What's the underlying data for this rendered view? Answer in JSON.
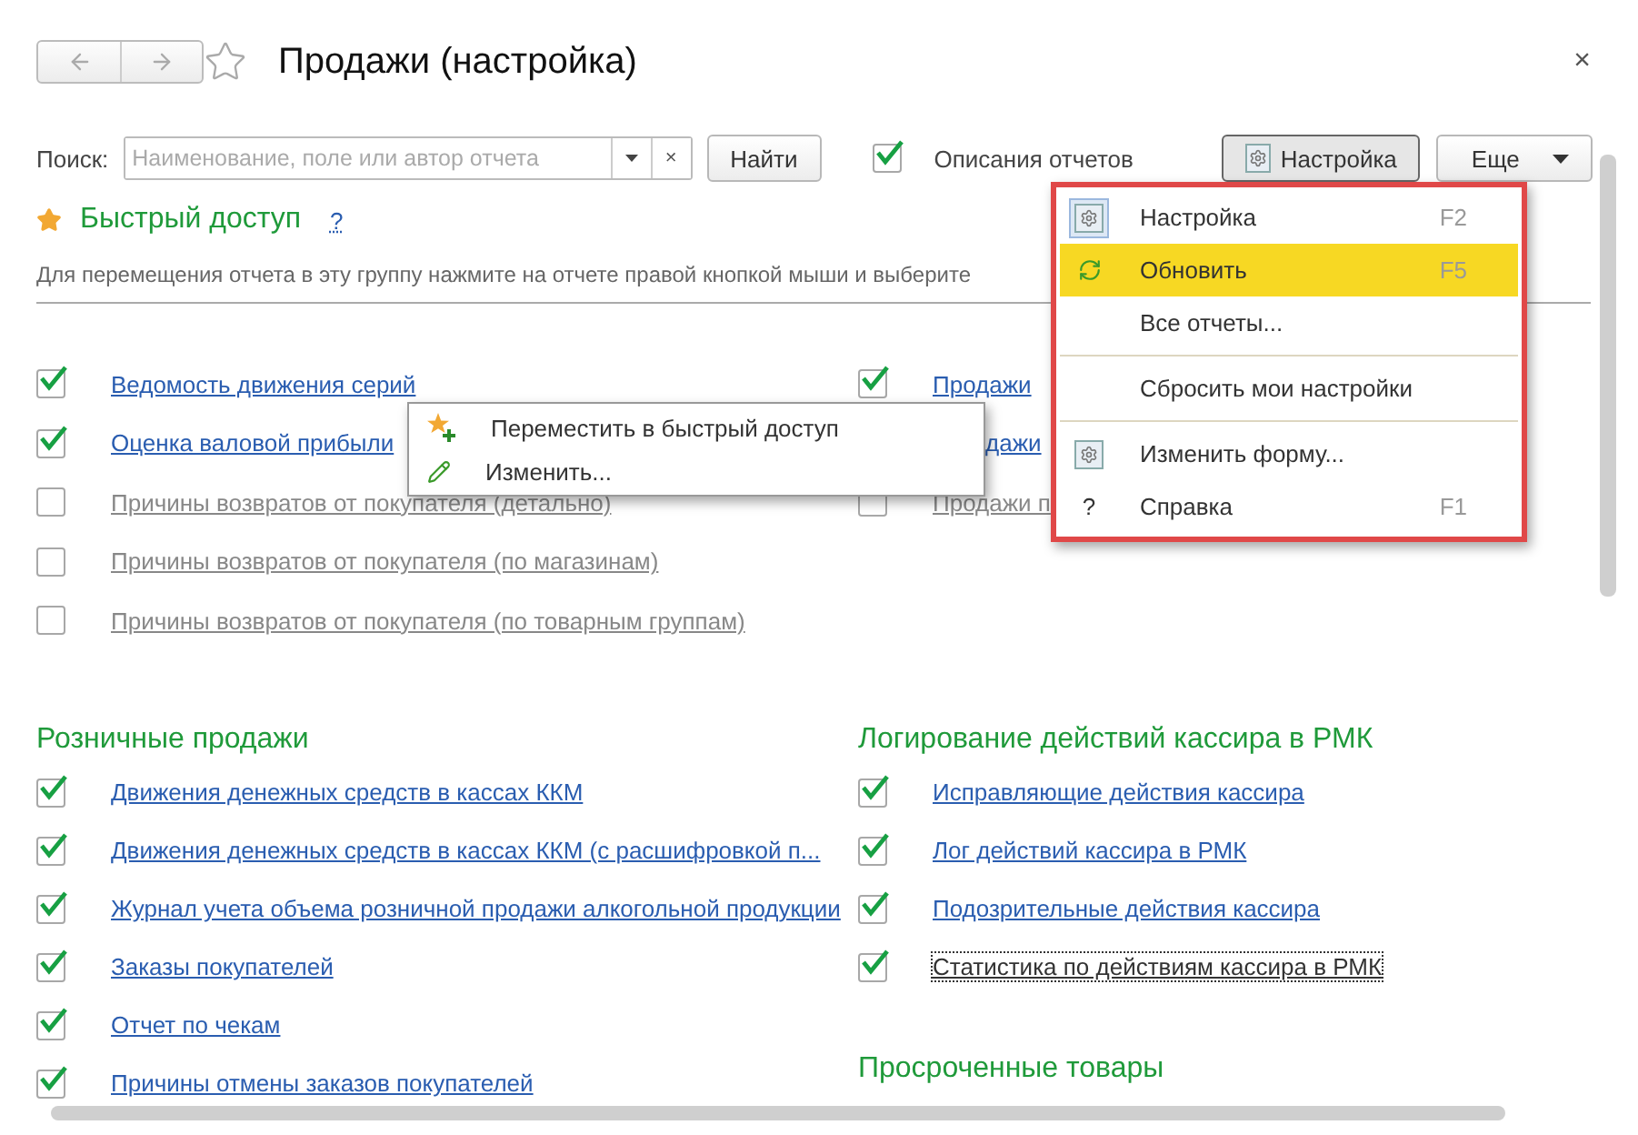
{
  "window": {
    "title": "Продажи (настройка)",
    "close": "×"
  },
  "search": {
    "label": "Поиск:",
    "placeholder": "Наименование, поле или автор отчета",
    "clear": "×"
  },
  "find_button": "Найти",
  "descriptions": {
    "label": "Описания отчетов",
    "checked": true
  },
  "settings_button": {
    "label": "Настройка",
    "pressed": true
  },
  "more_button": "Еще",
  "quick_access": {
    "title": "Быстрый доступ",
    "help": "?",
    "hint": "Для перемещения отчета в эту группу нажмите на отчете правой кнопкой мыши и выберите",
    "left": [
      {
        "label": "Ведомость движения серий",
        "checked": true
      },
      {
        "label": "Оценка валовой прибыли",
        "checked": true
      },
      {
        "label": "Причины возвратов от покупателя (детально)",
        "checked": false
      },
      {
        "label": "Причины возвратов от покупателя (по магазинам)",
        "checked": false
      },
      {
        "label": "Причины возвратов от покупателя (по товарным группам)",
        "checked": false
      }
    ],
    "right": [
      {
        "label": "Продажи",
        "checked": true,
        "covered": false
      },
      {
        "label": "дажи",
        "covered": true
      },
      {
        "label": "Продажи п",
        "checked": false,
        "covered": false
      }
    ]
  },
  "columns": [
    [
      {
        "title": "Розничные продажи",
        "items": [
          {
            "label": "Движения денежных средств в кассах ККМ",
            "checked": true,
            "focused": false
          },
          {
            "label": "Движения денежных средств в кассах ККМ (с расшифровкой п...",
            "checked": true,
            "focused": false
          },
          {
            "label": "Журнал учета объема розничной продажи алкогольной продукции",
            "checked": true,
            "focused": false
          },
          {
            "label": "Заказы покупателей",
            "checked": true,
            "focused": false
          },
          {
            "label": "Отчет по чекам",
            "checked": true,
            "focused": false
          },
          {
            "label": "Причины отмены заказов покупателей",
            "checked": true,
            "focused": false
          }
        ]
      }
    ],
    [
      {
        "title": "Логирование действий кассира в РМК",
        "items": [
          {
            "label": "Исправляющие действия кассира",
            "checked": true,
            "focused": false
          },
          {
            "label": "Лог действий кассира в РМК",
            "checked": true,
            "focused": false
          },
          {
            "label": "Подозрительные действия кассира",
            "checked": true,
            "focused": false
          },
          {
            "label": "Статистика по действиям кассира в РМК",
            "checked": true,
            "focused": true
          }
        ]
      },
      {
        "title": "Просроченные товары"
      }
    ]
  ],
  "context_menu": [
    {
      "kind": "favorite",
      "label": "Переместить в быстрый доступ"
    },
    {
      "kind": "edit",
      "label": "Изменить..."
    }
  ],
  "dropdown_menu": [
    {
      "kind": "gear",
      "label": "Настройка",
      "shortcut": "F2",
      "checked": true,
      "selected": false
    },
    {
      "kind": "refresh",
      "label": "Обновить",
      "shortcut": "F5",
      "checked": false,
      "selected": true
    },
    {
      "kind": "plain",
      "label": "Все отчеты...",
      "checked": false,
      "selected": false
    },
    {
      "kind": "separator"
    },
    {
      "kind": "plain",
      "label": "Сбросить мои настройки",
      "checked": false,
      "selected": false
    },
    {
      "kind": "separator"
    },
    {
      "kind": "gear",
      "label": "Изменить форму...",
      "checked": false,
      "selected": false
    },
    {
      "kind": "help",
      "symbol": "?",
      "label": "Справка",
      "shortcut": "F1",
      "checked": false,
      "selected": false
    }
  ]
}
